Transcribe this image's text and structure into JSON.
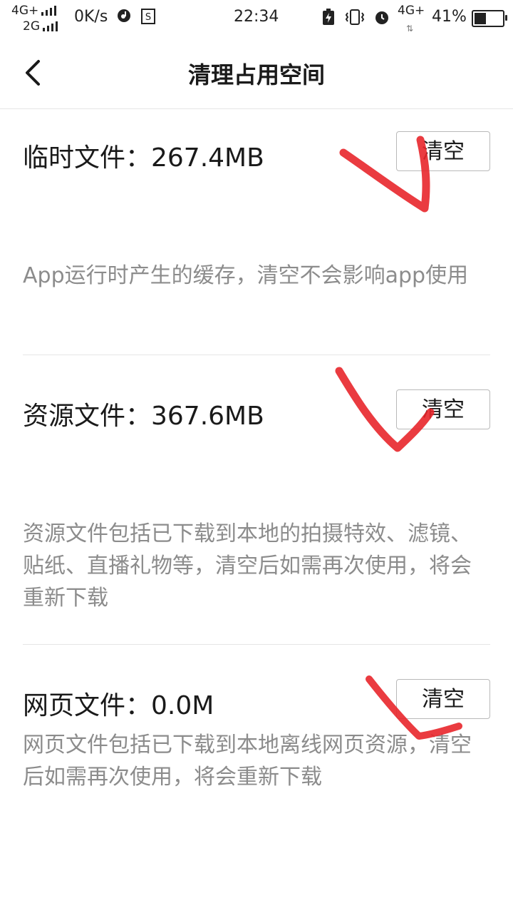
{
  "status_bar": {
    "network_top": "4G+",
    "network_bottom": "2G",
    "speed": "0K/s",
    "time": "22:34",
    "network_right": "4G+",
    "battery": "41%",
    "battery_level": 0.41,
    "icons": [
      "music-icon",
      "s-app-icon",
      "charging-icon",
      "vibrate-icon",
      "alarm-icon"
    ]
  },
  "nav": {
    "title": "清理占用空间",
    "back_icon": "chevron-left-icon"
  },
  "sections": [
    {
      "title": "临时文件：267.4MB",
      "button": "清空",
      "desc": "App运行时产生的缓存，清空不会影响app使用"
    },
    {
      "title": "资源文件：367.6MB",
      "button": "清空",
      "desc": "资源文件包括已下载到本地的拍摄特效、滤镜、贴纸、直播礼物等，清空后如需再次使用，将会重新下载"
    },
    {
      "title": "网页文件：0.0M",
      "button": "清空",
      "desc": "网页文件包括已下载到本地离线网页资源，清空后如需再次使用，将会重新下载"
    }
  ],
  "colors": {
    "annotation_mark": "#e8262b",
    "desc_text": "#8c8c8c",
    "divider": "#e6e6e6"
  }
}
